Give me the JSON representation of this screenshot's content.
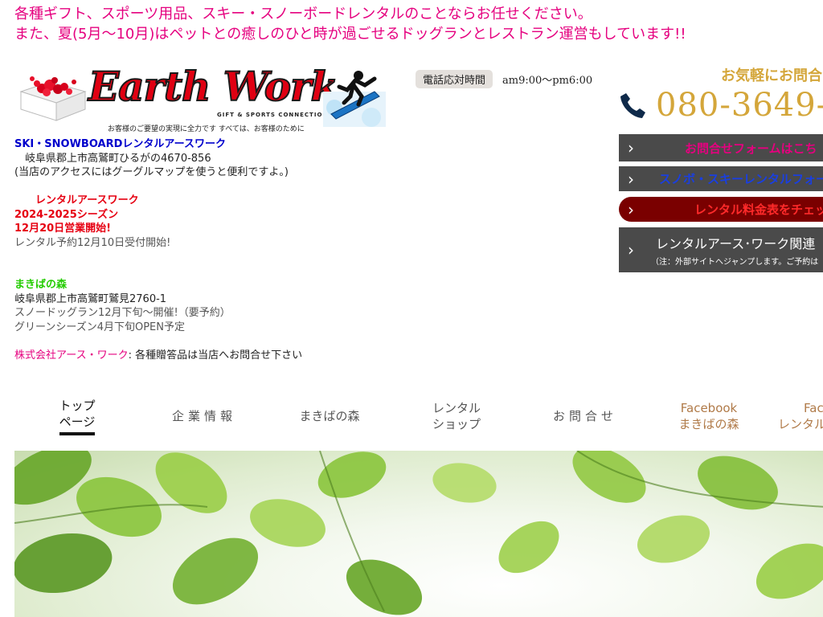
{
  "banner": {
    "line1": "各種ギフト、スポーツ用品、スキー・スノーボードレンタルのことならお任せください。",
    "line2": "また、夏(5月～10月)はペットとの癒しのひと時が過ごせるドッグランとレストラン運営もしています!!"
  },
  "logo": {
    "brand": "Earth Work",
    "sub": "GIFT & SPORTS CONNECTION STORE",
    "tagline": "お客様のご要望の実現に全力です すべては、お客様のために"
  },
  "info": {
    "shop_name": "SKI・SNOWBOARDレンタルアースワーク",
    "shop_address": "　岐阜県郡上市高鷲町ひるがの4670-856",
    "access_note": "(当店のアクセスにはグーグルマップを使うと便利ですよ。)",
    "season_title": "　　レンタルアースワーク",
    "season_name": "2024-2025シーズン",
    "season_open": "12月20日営業開始!",
    "reservation": "レンタル予約12月10日受付開始!",
    "forest_name": "まきばの森",
    "forest_address": "岐阜県郡上市高鷲町鷲見2760-1",
    "snow_dog": "スノードッグラン12月下旬～開催!（要予約）",
    "green_season": "グリーンシーズン4月下旬OPEN予定",
    "company": "株式会社アース・ワーク",
    "company_note": ": 各種贈答品は当店へお問合せ下さい"
  },
  "hours": {
    "label": "電話応対時間",
    "time": "am9:00～pm6:00"
  },
  "contact": {
    "heading": "お気軽にお問合",
    "phone": "080-3649-",
    "btn_inquiry": "お問合せフォームはこち",
    "btn_rental_form": "スノボ・スキーレンタルフォーム",
    "btn_price": "レンタル料金表をチェッ",
    "btn_related": "レンタルアース･ワーク関連",
    "btn_related_note": "（注：外部サイトへジャンプします。ご予約は"
  },
  "nav": {
    "top_1": "トップ",
    "top_2": "ページ",
    "company": "企業情報",
    "forest": "まきばの森",
    "rental_1": "レンタル",
    "rental_2": "ショップ",
    "contact": "お問合せ",
    "fb1_1": "Facebook",
    "fb1_2": "まきばの森",
    "fb2_1": "Fac",
    "fb2_2": "レンタル"
  },
  "colors": {
    "banner_pink": "#e5007f",
    "gold": "#d4a63a",
    "button_gray": "#4a4a4a",
    "button_darkred": "#7a0000"
  }
}
